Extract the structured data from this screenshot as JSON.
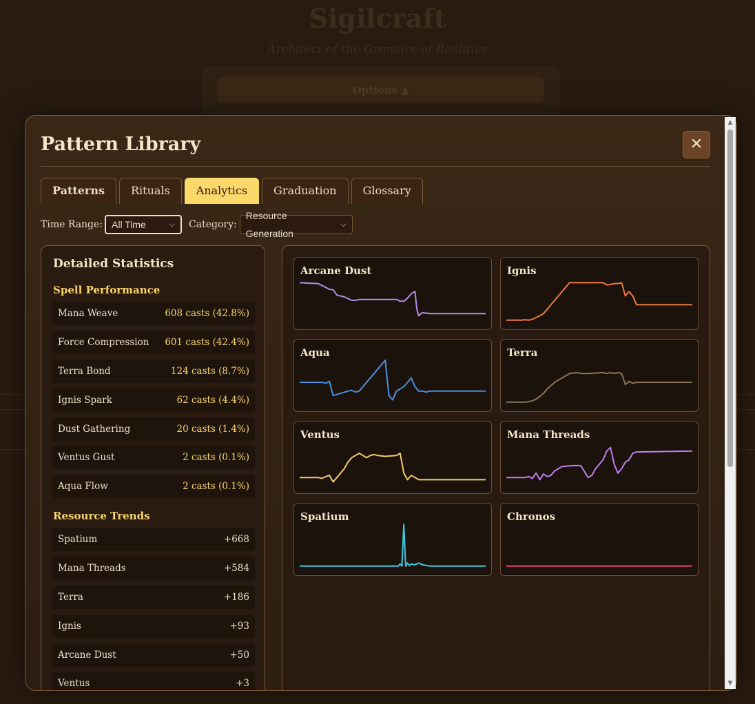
{
  "background": {
    "title": "Sigilcraft",
    "subtitle": "Architect of the Grimoire of Realities",
    "options_label": "Options ▲"
  },
  "modal": {
    "title": "Pattern Library",
    "close_icon": "close-icon",
    "tabs": [
      {
        "label": "Patterns",
        "active": false
      },
      {
        "label": "Rituals",
        "active": false
      },
      {
        "label": "Analytics",
        "active": true
      },
      {
        "label": "Graduation",
        "active": false
      },
      {
        "label": "Glossary",
        "active": false
      }
    ],
    "filters": {
      "time_range_label": "Time Range:",
      "time_range_value": "All Time",
      "category_label": "Category:",
      "category_value": "Resource Generation"
    }
  },
  "stats": {
    "heading": "Detailed Statistics",
    "spell_title": "Spell Performance",
    "spells": [
      {
        "name": "Mana Weave",
        "value": "608 casts (42.8%)"
      },
      {
        "name": "Force Compression",
        "value": "601 casts (42.4%)"
      },
      {
        "name": "Terra Bond",
        "value": "124 casts (8.7%)"
      },
      {
        "name": "Ignis Spark",
        "value": "62 casts (4.4%)"
      },
      {
        "name": "Dust Gathering",
        "value": "20 casts (1.4%)"
      },
      {
        "name": "Ventus Gust",
        "value": "2 casts (0.1%)"
      },
      {
        "name": "Aqua Flow",
        "value": "2 casts (0.1%)"
      }
    ],
    "trends_title": "Resource Trends",
    "trends": [
      {
        "name": "Spatium",
        "value": "+668"
      },
      {
        "name": "Mana Threads",
        "value": "+584"
      },
      {
        "name": "Terra",
        "value": "+186"
      },
      {
        "name": "Ignis",
        "value": "+93"
      },
      {
        "name": "Arcane Dust",
        "value": "+50"
      },
      {
        "name": "Ventus",
        "value": "+3"
      }
    ]
  },
  "chart_data": [
    {
      "type": "line",
      "title": "Arcane Dust",
      "color": "#b48ee0",
      "x": [
        0,
        10,
        16,
        18,
        20,
        22,
        24,
        28,
        30,
        32,
        52,
        54,
        56,
        58,
        60,
        62,
        63,
        64,
        66,
        70,
        100
      ],
      "y": [
        90,
        88,
        75,
        74,
        62,
        60,
        58,
        50,
        50,
        52,
        52,
        48,
        48,
        55,
        65,
        70,
        30,
        15,
        22,
        20,
        20
      ]
    },
    {
      "type": "line",
      "title": "Ignis",
      "color": "#f07a42",
      "x": [
        0,
        8,
        10,
        12,
        14,
        18,
        20,
        22,
        24,
        26,
        28,
        30,
        32,
        34,
        52,
        54,
        56,
        58,
        60,
        62,
        64,
        66,
        68,
        70,
        100
      ],
      "y": [
        5,
        5,
        6,
        5,
        7,
        15,
        20,
        30,
        40,
        50,
        60,
        70,
        80,
        90,
        90,
        85,
        86,
        88,
        88,
        90,
        60,
        70,
        60,
        40,
        40
      ]
    },
    {
      "type": "line",
      "title": "Aqua",
      "color": "#4a90e0",
      "x": [
        0,
        12,
        14,
        16,
        18,
        26,
        28,
        30,
        32,
        34,
        36,
        38,
        40,
        42,
        44,
        46,
        48,
        50,
        52,
        56,
        58,
        60,
        62,
        64,
        66,
        68,
        70,
        100
      ],
      "y": [
        50,
        50,
        48,
        52,
        20,
        30,
        32,
        28,
        30,
        40,
        50,
        60,
        70,
        80,
        90,
        100,
        20,
        10,
        30,
        40,
        50,
        60,
        40,
        30,
        30,
        28,
        30,
        30
      ]
    },
    {
      "type": "line",
      "title": "Terra",
      "color": "#8c7458",
      "x": [
        0,
        10,
        12,
        14,
        16,
        18,
        20,
        22,
        26,
        30,
        34,
        38,
        40,
        44,
        52,
        54,
        56,
        58,
        60,
        62,
        64,
        66,
        68,
        70,
        100
      ],
      "y": [
        5,
        5,
        6,
        8,
        12,
        18,
        25,
        35,
        50,
        60,
        70,
        72,
        70,
        70,
        72,
        70,
        72,
        70,
        72,
        70,
        45,
        52,
        48,
        50,
        50
      ]
    },
    {
      "type": "line",
      "title": "Ventus",
      "color": "#f2cf6a",
      "x": [
        0,
        10,
        12,
        14,
        16,
        18,
        20,
        22,
        24,
        26,
        28,
        30,
        32,
        34,
        36,
        38,
        40,
        42,
        46,
        52,
        54,
        56,
        58,
        60,
        62,
        64,
        66,
        68,
        100
      ],
      "y": [
        20,
        20,
        18,
        22,
        25,
        10,
        20,
        30,
        40,
        55,
        65,
        70,
        75,
        70,
        65,
        70,
        72,
        70,
        68,
        70,
        75,
        30,
        15,
        25,
        20,
        15,
        15,
        15,
        15
      ]
    },
    {
      "type": "line",
      "title": "Mana Threads",
      "color": "#c080f0",
      "x": [
        0,
        10,
        12,
        14,
        16,
        18,
        20,
        22,
        24,
        26,
        28,
        30,
        36,
        40,
        44,
        46,
        48,
        52,
        54,
        56,
        58,
        60,
        62,
        64,
        66,
        68,
        70,
        100
      ],
      "y": [
        20,
        20,
        22,
        18,
        30,
        15,
        28,
        22,
        25,
        35,
        40,
        45,
        47,
        47,
        20,
        25,
        40,
        60,
        80,
        88,
        50,
        30,
        40,
        55,
        60,
        75,
        78,
        80
      ]
    },
    {
      "type": "line",
      "title": "Spatium",
      "color": "#3ec8e0",
      "x": [
        0,
        50,
        53,
        54,
        55,
        56,
        57,
        58,
        59,
        60,
        62,
        64,
        66,
        70,
        100
      ],
      "y": [
        5,
        5,
        5,
        10,
        5,
        100,
        5,
        12,
        6,
        10,
        8,
        12,
        8,
        5,
        5
      ]
    },
    {
      "type": "line",
      "title": "Chronos",
      "color": "#e0457a",
      "x": [
        0,
        100
      ],
      "y": [
        5,
        5
      ]
    }
  ]
}
